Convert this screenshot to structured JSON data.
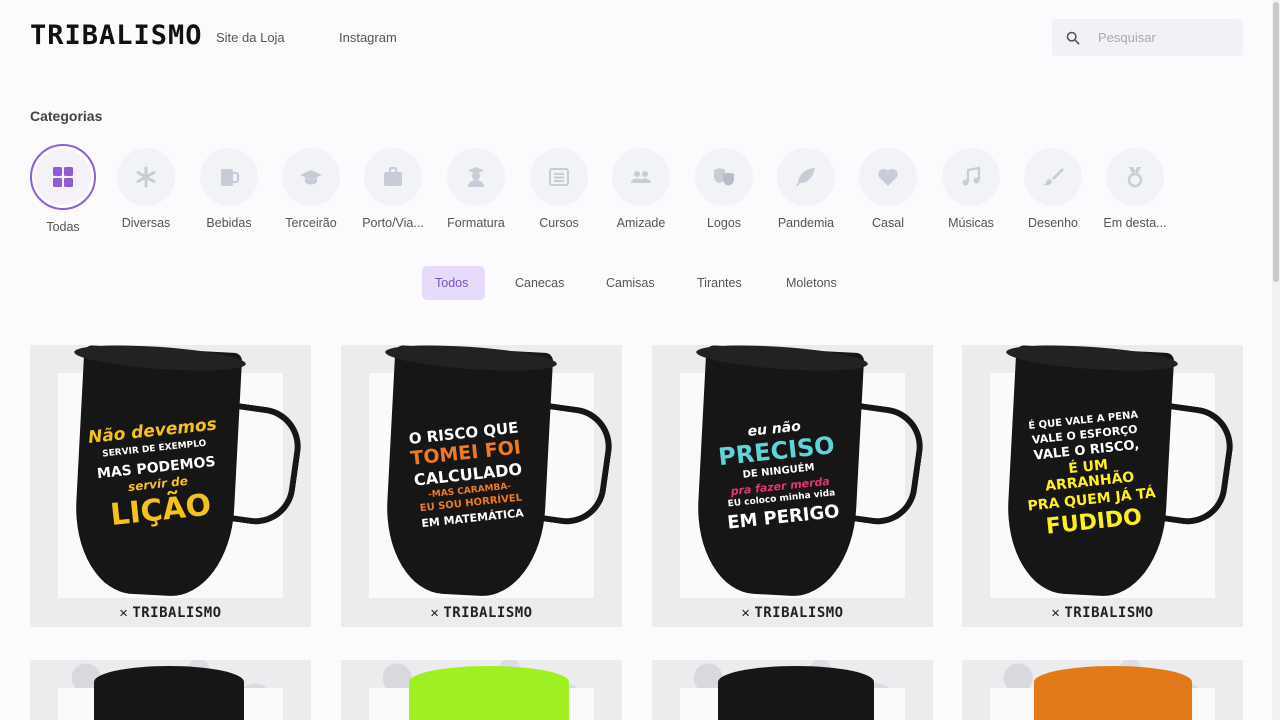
{
  "header": {
    "logo_text": "TRIBALISMO",
    "nav": [
      {
        "label": "Site da Loja"
      },
      {
        "label": "Instagram"
      }
    ],
    "search_placeholder": "Pesquisar"
  },
  "categories": {
    "title": "Categorias",
    "items": [
      {
        "label": "Todas",
        "icon": "grid-icon",
        "active": true
      },
      {
        "label": "Diversas",
        "icon": "asterisk-icon"
      },
      {
        "label": "Bebidas",
        "icon": "beer-mug-icon"
      },
      {
        "label": "Terceirão",
        "icon": "graduation-cap-icon"
      },
      {
        "label": "Porto/Via...",
        "icon": "suitcase-icon"
      },
      {
        "label": "Formatura",
        "icon": "graduate-user-icon"
      },
      {
        "label": "Cursos",
        "icon": "list-icon"
      },
      {
        "label": "Amizade",
        "icon": "users-icon"
      },
      {
        "label": "Logos",
        "icon": "theater-mask-icon"
      },
      {
        "label": "Pandemia",
        "icon": "feather-icon"
      },
      {
        "label": "Casal",
        "icon": "heart-icon"
      },
      {
        "label": "Músicas",
        "icon": "music-note-icon"
      },
      {
        "label": "Desenho",
        "icon": "paint-brush-icon"
      },
      {
        "label": "Em desta...",
        "icon": "medal-icon"
      }
    ]
  },
  "filters": {
    "tabs": [
      {
        "label": "Todos",
        "active": true
      },
      {
        "label": "Canecas"
      },
      {
        "label": "Camisas"
      },
      {
        "label": "Tirantes"
      },
      {
        "label": "Moletons"
      }
    ]
  },
  "products": [
    {
      "brand": "TRIBALISMO",
      "phrase": [
        "Não devemos",
        "SERVIR DE EXEMPLO",
        "MAS PODEMOS",
        "servir de",
        "LIÇÃO"
      ],
      "colors": [
        "#f4c21a",
        "#ffffff",
        "#ffffff",
        "#f4c21a",
        "#f4c21a"
      ]
    },
    {
      "brand": "TRIBALISMO",
      "phrase": [
        "O RISCO QUE",
        "TOMEI FOI",
        "CALCULADO",
        "-MAS CARAMBA-",
        "EU SOU HORRÍVEL",
        "EM MATEMÁTICA"
      ],
      "colors": [
        "#ffffff",
        "#f07a20",
        "#ffffff",
        "#f07a20",
        "#f07a20",
        "#ffffff"
      ]
    },
    {
      "brand": "TRIBALISMO",
      "phrase": [
        "eu não",
        "PRECISO",
        "DE NINGUÉM",
        "pra fazer merda",
        "EU coloco minha vida",
        "EM PERIGO"
      ],
      "colors": [
        "#ffffff",
        "#5fd3d6",
        "#ffffff",
        "#e8336f",
        "#ffffff",
        "#ffffff"
      ]
    },
    {
      "brand": "TRIBALISMO",
      "phrase": [
        "É QUE VALE A PENA",
        "VALE O ESFORÇO",
        "VALE O RISCO,",
        "É UM ARRANHÃO",
        "PRA QUEM JÁ TÁ",
        "FUDIDO"
      ],
      "colors": [
        "#ffffff",
        "#ffffff",
        "#ffffff",
        "#ffef1a",
        "#ffef1a",
        "#ffef1a"
      ]
    }
  ],
  "accent_color": "#8e5dd4",
  "tab_active_bg": "#e6dcf9"
}
